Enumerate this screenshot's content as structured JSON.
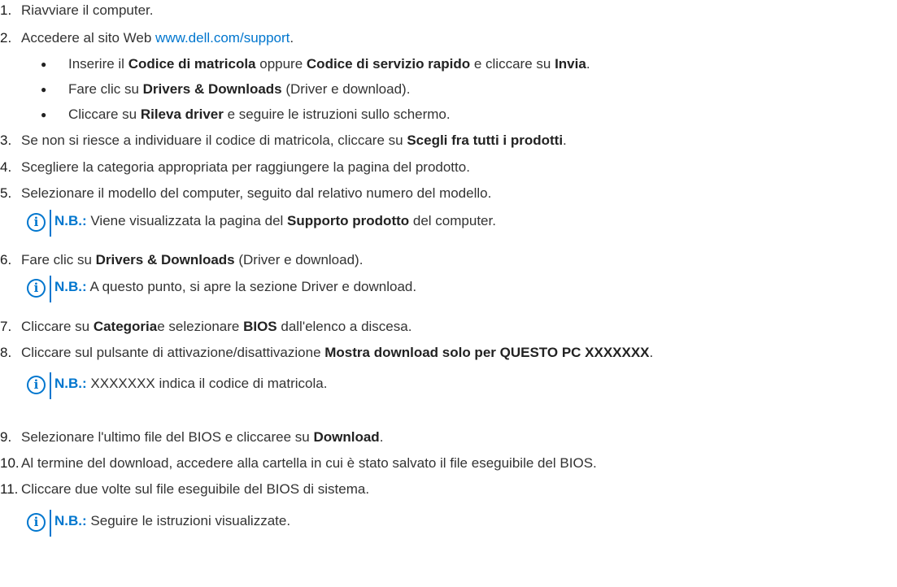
{
  "steps": {
    "s1": {
      "num": "1.",
      "text": "Riavviare il computer."
    },
    "s2": {
      "num": "2.",
      "text": "Accedere al sito Web ",
      "link": "www.dell.com/support",
      "end": "."
    },
    "b1": {
      "p1": "Inserire il ",
      "b1": "Codice di matricola",
      "p2": " oppure ",
      "b2": "Codice di servizio rapido",
      "p3": " e cliccare su ",
      "b3": "Invia",
      "p4": "."
    },
    "b2": {
      "p1": "Fare clic su ",
      "b1": "Drivers & Downloads",
      "p2": " (Driver e download)."
    },
    "b3": {
      "p1": "Cliccare su ",
      "b1": "Rileva driver",
      "p2": " e seguire le istruzioni sullo schermo."
    },
    "s3": {
      "num": "3.",
      "p1": "Se non si riesce a individuare il codice di matricola, cliccare su ",
      "b1": "Scegli fra tutti i prodotti",
      "p2": "."
    },
    "s4": {
      "num": "4.",
      "text": "Scegliere la categoria appropriata per raggiungere la pagina del prodotto."
    },
    "s5": {
      "num": "5.",
      "text": "Selezionare il modello del computer, seguito dal relativo numero del modello."
    },
    "n1": {
      "label": "N.B.:",
      "p1": " Viene visualizzata la pagina del ",
      "b1": "Supporto prodotto",
      "p2": " del computer."
    },
    "s6": {
      "num": "6.",
      "p1": "Fare clic su ",
      "b1": "Drivers & Downloads",
      "p2": " (Driver e download)."
    },
    "n2": {
      "label": "N.B.:",
      "p1": " A questo punto, si apre la sezione Driver e download."
    },
    "s7": {
      "num": "7.",
      "p1": "Cliccare su ",
      "b1": "Categoria",
      "p2": "e selezionare ",
      "b2": "BIOS",
      "p3": " dall'elenco a discesa."
    },
    "s8": {
      "num": "8.",
      "p1": "Cliccare sul pulsante di attivazione/disattivazione ",
      "b1": "Mostra download solo per QUESTO PC XXXXXXX",
      "p2": "."
    },
    "n3": {
      "label": "N.B.:",
      "p1": " XXXXXXX indica il codice di matricola."
    },
    "s9": {
      "num": "9.",
      "p1": "Selezionare l'ultimo file del BIOS e cliccaree su ",
      "b1": "Download",
      "p2": "."
    },
    "s10": {
      "num": "10.",
      "text": "Al termine del download, accedere alla cartella in cui è stato salvato il file eseguibile del BIOS."
    },
    "s11": {
      "num": "11.",
      "text": "Cliccare due volte sul file eseguibile del BIOS di sistema."
    },
    "n4": {
      "label": "N.B.:",
      "p1": " Seguire le istruzioni visualizzate."
    }
  },
  "icons": {
    "note": "info-circle-icon",
    "bullet": "bullet-dot-icon"
  },
  "colors": {
    "accent": "#0076ce",
    "text": "#333333"
  }
}
